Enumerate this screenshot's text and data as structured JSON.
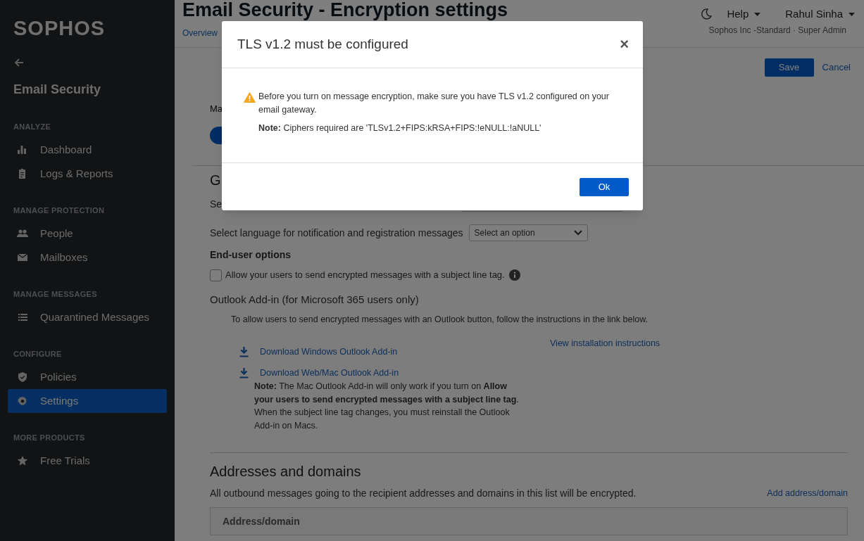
{
  "sidebar": {
    "logo": "SOPHOS",
    "product": "Email Security",
    "sections": [
      {
        "heading": "ANALYZE",
        "items": [
          {
            "label": "Dashboard",
            "selected": false
          },
          {
            "label": "Logs & Reports",
            "selected": false
          }
        ]
      },
      {
        "heading": "MANAGE PROTECTION",
        "items": [
          {
            "label": "People",
            "selected": false
          },
          {
            "label": "Mailboxes",
            "selected": false
          }
        ]
      },
      {
        "heading": "MANAGE MESSAGES",
        "items": [
          {
            "label": "Quarantined Messages",
            "selected": false
          }
        ]
      },
      {
        "heading": "CONFIGURE",
        "items": [
          {
            "label": "Policies",
            "selected": false
          },
          {
            "label": "Settings",
            "selected": true
          }
        ]
      },
      {
        "heading": "MORE PRODUCTS",
        "items": [
          {
            "label": "Free Trials",
            "selected": false
          }
        ]
      }
    ]
  },
  "header": {
    "title": "Email Security - Encryption settings",
    "breadcrumb": "Overview",
    "help": "Help",
    "user": "Rahul Sinha",
    "account": "Sophos Inc -Standard · Super Admin"
  },
  "actions": {
    "save": "Save",
    "cancel": "Cancel"
  },
  "encryption": {
    "label": "Ma"
  },
  "general": {
    "heading": "G",
    "setting_label": "Se",
    "language_label": "Select language for notification and registration messages",
    "language_select": {
      "value": "Select an option"
    }
  },
  "end_user_options": {
    "heading": "End-user options",
    "subject_tag": {
      "label": "Allow your users to send encrypted messages with a subject line tag.",
      "checked": false
    }
  },
  "outlook_addin": {
    "heading": "Outlook Add-in (for Microsoft 365 users only)",
    "intro": "To allow users to send encrypted messages with an Outlook button, follow the instructions in the link below.",
    "instructions_link": "View installation instructions",
    "downloads": [
      "Download Windows Outlook Add-in",
      "Download Web/Mac Outlook Add-in"
    ],
    "note": "**Note:** The Mac Outlook Add-in will only work if you turn on **Allow your users to send encrypted messages with a subject line tag**. When the subject line tag changes, you must reinstall the Outlook Add-in on Macs."
  },
  "addresses": {
    "heading": "Addresses and domains",
    "description": "All outbound messages going to the recipient addresses and domains in this list will be encrypted.",
    "add_link": "Add address/domain",
    "table": {
      "columns": [
        "Address/domain"
      ]
    }
  },
  "dialog": {
    "title": "TLS v1.2 must be configured",
    "close": "×",
    "message": "Before you turn on message encryption, make sure you have TLS v1.2 configured on your email gateway.",
    "note": "**Note:** Ciphers required are 'TLSv1.2+FIPS:kRSA+FIPS:!eNULL:!aNULL'",
    "ok": "Ok"
  }
}
